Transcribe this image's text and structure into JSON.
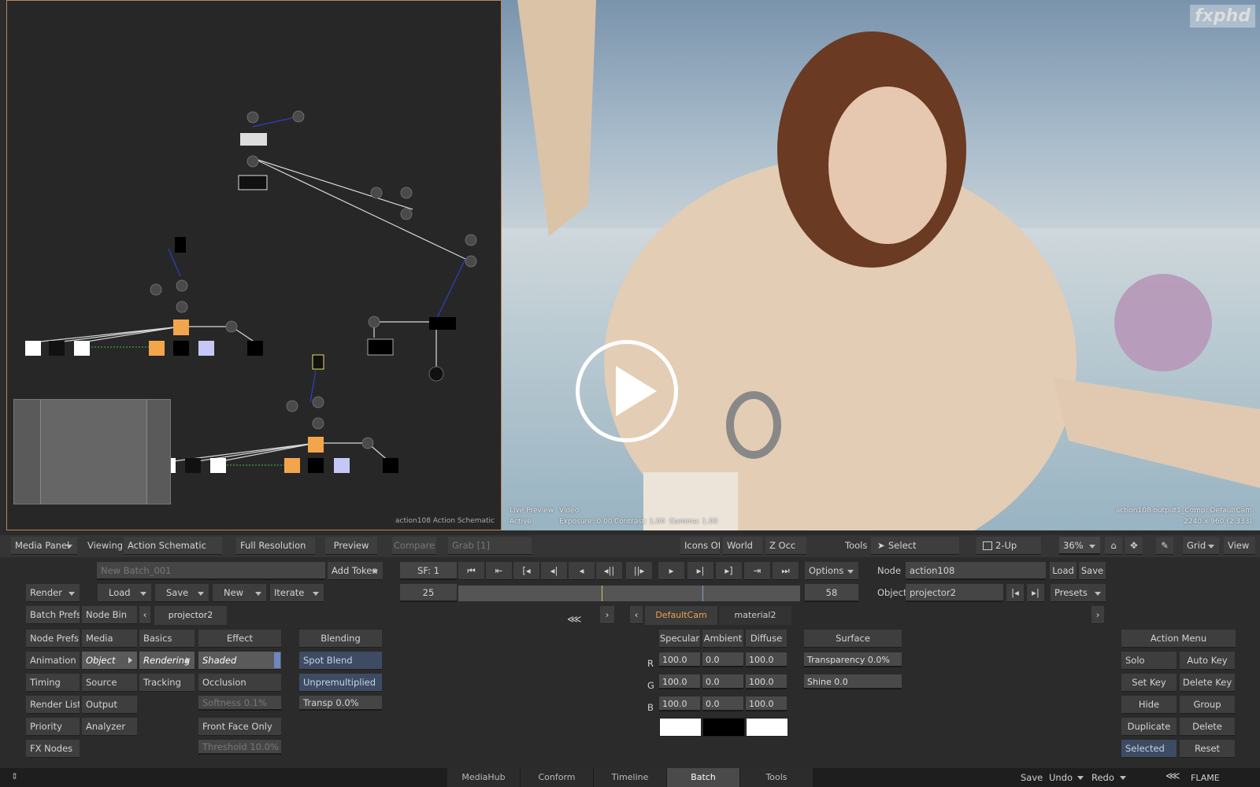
{
  "schematic": {
    "label": "action108 Action Schematic"
  },
  "viewer": {
    "logo": "fxphd",
    "live_preview": "Live Preview",
    "active": "Active",
    "video": "Video",
    "exposure": "Exposure: 0.00",
    "contrast": "Contrast: 1.00",
    "gamma": "Gamma: 1.00",
    "output_info": "action108 output1_Comp: DefaultCam",
    "resolution": "2240 x 960 (2.333)"
  },
  "toolbar": {
    "media_panel": "Media Panel",
    "viewing_label": "Viewing",
    "viewing_value": "Action Schematic",
    "full_resolution": "Full Resolution",
    "preview": "Preview",
    "compare": "Compare",
    "grab": "Grab [1]",
    "icons_off": "Icons Off",
    "world": "World",
    "z_occ": "Z Occ",
    "tools_label": "Tools",
    "select": "Select",
    "two_up": "2-Up",
    "zoom": "36%",
    "grid": "Grid",
    "view": "View"
  },
  "batch": {
    "name": "New Batch_001",
    "add_token": "Add Token",
    "render": "Render",
    "load": "Load",
    "save": "Save",
    "new": "New",
    "iterate": "Iterate",
    "batch_prefs": "Batch Prefs",
    "node_bin": "Node Bin",
    "node_tab": "projector2"
  },
  "transport": {
    "sf": "SF: 1",
    "start_frame": "25",
    "end_frame": "58",
    "options": "Options"
  },
  "node": {
    "node_label": "Node",
    "node_value": "action108",
    "load": "Load",
    "save": "Save",
    "object_label": "Object",
    "object_value": "projector2",
    "presets": "Presets"
  },
  "tabs": {
    "default_cam": "DefaultCam",
    "material2": "material2"
  },
  "left_menu": [
    "Node Prefs",
    "Animation",
    "Timing",
    "Render List",
    "Priority",
    "FX Nodes"
  ],
  "col2": [
    "Media",
    "Object",
    "Source",
    "Output",
    "Analyzer"
  ],
  "col3": [
    "Basics",
    "Rendering",
    "Tracking"
  ],
  "effect": {
    "header": "Effect",
    "shaded": "Shaded",
    "occlusion": "Occlusion",
    "softness": "Softness 0.1%",
    "front_face_only": "Front Face Only",
    "threshold": "Threshold 10.0%"
  },
  "blending": {
    "header": "Blending",
    "spot_blend": "Spot Blend",
    "unpremultiplied": "Unpremultiplied",
    "transp": "Transp 0.0%"
  },
  "material": {
    "specular": "Specular",
    "ambient": "Ambient",
    "diffuse": "Diffuse",
    "r": "R",
    "g": "G",
    "b": "B",
    "r_vals": [
      "100.0",
      "0.0",
      "100.0"
    ],
    "g_vals": [
      "100.0",
      "0.0",
      "100.0"
    ],
    "b_vals": [
      "100.0",
      "0.0",
      "100.0"
    ],
    "swatch_colors": [
      "#ffffff",
      "#000000",
      "#ffffff"
    ]
  },
  "surface": {
    "header": "Surface",
    "transparency": "Transparency 0.0%",
    "shine": "Shine 0.0"
  },
  "action_menu": {
    "header": "Action Menu",
    "solo": "Solo",
    "auto_key": "Auto Key",
    "set_key": "Set Key",
    "delete_key": "Delete Key",
    "hide": "Hide",
    "group": "Group",
    "duplicate": "Duplicate",
    "delete": "Delete",
    "selected": "Selected",
    "reset": "Reset"
  },
  "bottom_tabs": [
    "MediaHub",
    "Conform",
    "Timeline",
    "Batch",
    "Tools"
  ],
  "bottom_right": {
    "save": "Save",
    "undo": "Undo",
    "redo": "Redo",
    "flame": "FLAME"
  },
  "colors": {
    "accent": "#f0a24a",
    "active_tab": "#f0a24a",
    "selected_blue": "#3d4c63"
  }
}
